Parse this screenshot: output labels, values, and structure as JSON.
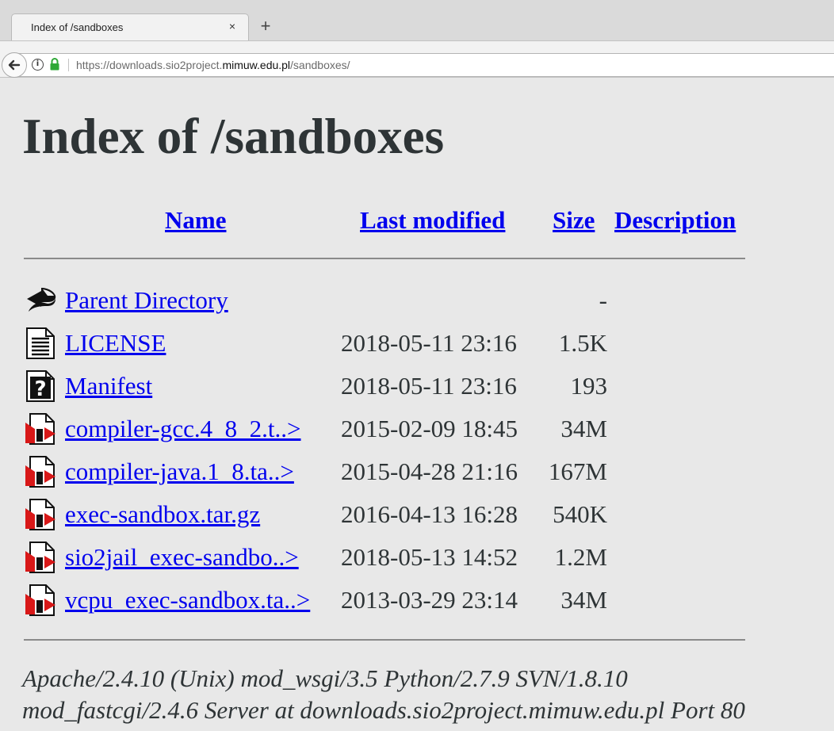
{
  "browser": {
    "tab_title": "Index of /sandboxes",
    "tab_close": "×",
    "new_tab": "+",
    "back": "🡐",
    "info": "i",
    "url_prefix": "https://downloads.sio2project.",
    "url_host": "mimuw.edu.pl",
    "url_path": "/sandboxes/"
  },
  "page": {
    "title": "Index of /sandboxes",
    "headers": {
      "name": "Name",
      "last_modified": "Last modified",
      "size": "Size",
      "description": "Description"
    },
    "rows": [
      {
        "icon": "back-icon",
        "name": "Parent Directory",
        "date": "",
        "size": "-"
      },
      {
        "icon": "text-file-icon",
        "name": "LICENSE",
        "date": "2018-05-11 23:16",
        "size": "1.5K"
      },
      {
        "icon": "unknown-file-icon",
        "name": "Manifest",
        "date": "2018-05-11 23:16",
        "size": "193"
      },
      {
        "icon": "compressed-file-icon",
        "name": "compiler-gcc.4_8_2.t..>",
        "date": "2015-02-09 18:45",
        "size": "34M"
      },
      {
        "icon": "compressed-file-icon",
        "name": "compiler-java.1_8.ta..>",
        "date": "2015-04-28 21:16",
        "size": "167M"
      },
      {
        "icon": "compressed-file-icon",
        "name": "exec-sandbox.tar.gz",
        "date": "2016-04-13 16:28",
        "size": "540K"
      },
      {
        "icon": "compressed-file-icon",
        "name": "sio2jail_exec-sandbo..>",
        "date": "2018-05-13 14:52",
        "size": "1.2M"
      },
      {
        "icon": "compressed-file-icon",
        "name": "vcpu_exec-sandbox.ta..>",
        "date": "2013-03-29 23:14",
        "size": "34M"
      }
    ],
    "footer_line1": "Apache/2.4.10 (Unix) mod_wsgi/3.5 Python/2.7.9 SVN/1.8.10",
    "footer_line2": "mod_fastcgi/2.4.6 Server at downloads.sio2project.mimuw.edu.pl Port 80"
  },
  "colors": {
    "link": "#0000ee",
    "text": "#2e3436",
    "background": "#e8e8e8",
    "lock": "#2ea836"
  }
}
